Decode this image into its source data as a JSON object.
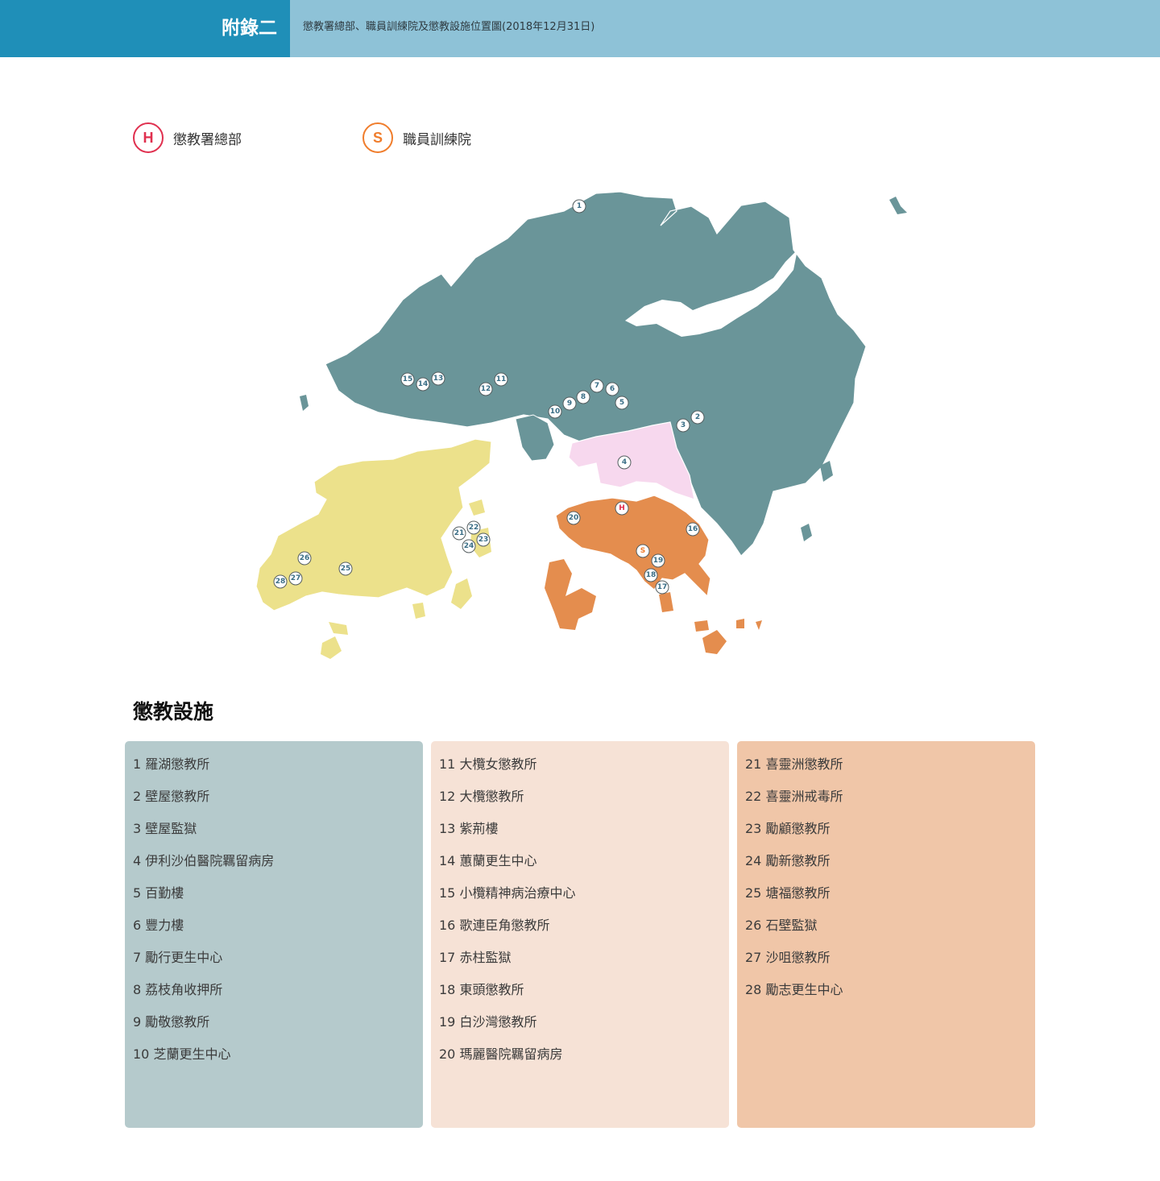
{
  "header": {
    "tag": "附錄二",
    "title": "懲教署總部、職員訓練院及懲教設施位置圖(2018年12月31日)"
  },
  "legend": [
    {
      "symbol": "H",
      "label": "懲教署總部",
      "color": "#e0304f"
    },
    {
      "symbol": "S",
      "label": "職員訓練院",
      "color": "#f07d2c"
    }
  ],
  "colors": {
    "new_territories": "#6a9599",
    "kowloon": "#f7d8ee",
    "hk_island": "#e48d4e",
    "islands": "#ece18b",
    "panel_1": "#b5cacc",
    "panel_2": "#f6e2d6",
    "panel_3": "#f0c6a8"
  },
  "map": {
    "markers": [
      "1",
      "2",
      "3",
      "4",
      "5",
      "6",
      "7",
      "8",
      "9",
      "10",
      "11",
      "12",
      "13",
      "14",
      "15",
      "16",
      "17",
      "18",
      "19",
      "20",
      "21",
      "22",
      "23",
      "24",
      "25",
      "26",
      "27",
      "28",
      "H",
      "S"
    ]
  },
  "section_title": "懲教設施",
  "facilities": {
    "col1": [
      "1 羅湖懲教所",
      "2 壁屋懲教所",
      "3 壁屋監獄",
      "4 伊利沙伯醫院羈留病房",
      "5 百勤樓",
      "6 豐力樓",
      "7 勵行更生中心",
      "8 荔枝角收押所",
      "9 勵敬懲教所",
      "10 芝蘭更生中心"
    ],
    "col2": [
      "11 大欖女懲教所",
      "12 大欖懲教所",
      "13 紫荊樓",
      "14 蕙蘭更生中心",
      "15 小欖精神病治療中心",
      "16 歌連臣角懲教所",
      "17 赤柱監獄",
      "18 東頭懲教所",
      "19 白沙灣懲教所",
      "20 瑪麗醫院羈留病房"
    ],
    "col3": [
      "21 喜靈洲懲教所",
      "22 喜靈洲戒毒所",
      "23 勵顧懲教所",
      "24 勵新懲教所",
      "25 塘福懲教所",
      "26 石壁監獄",
      "27 沙咀懲教所",
      "28 勵志更生中心"
    ]
  }
}
